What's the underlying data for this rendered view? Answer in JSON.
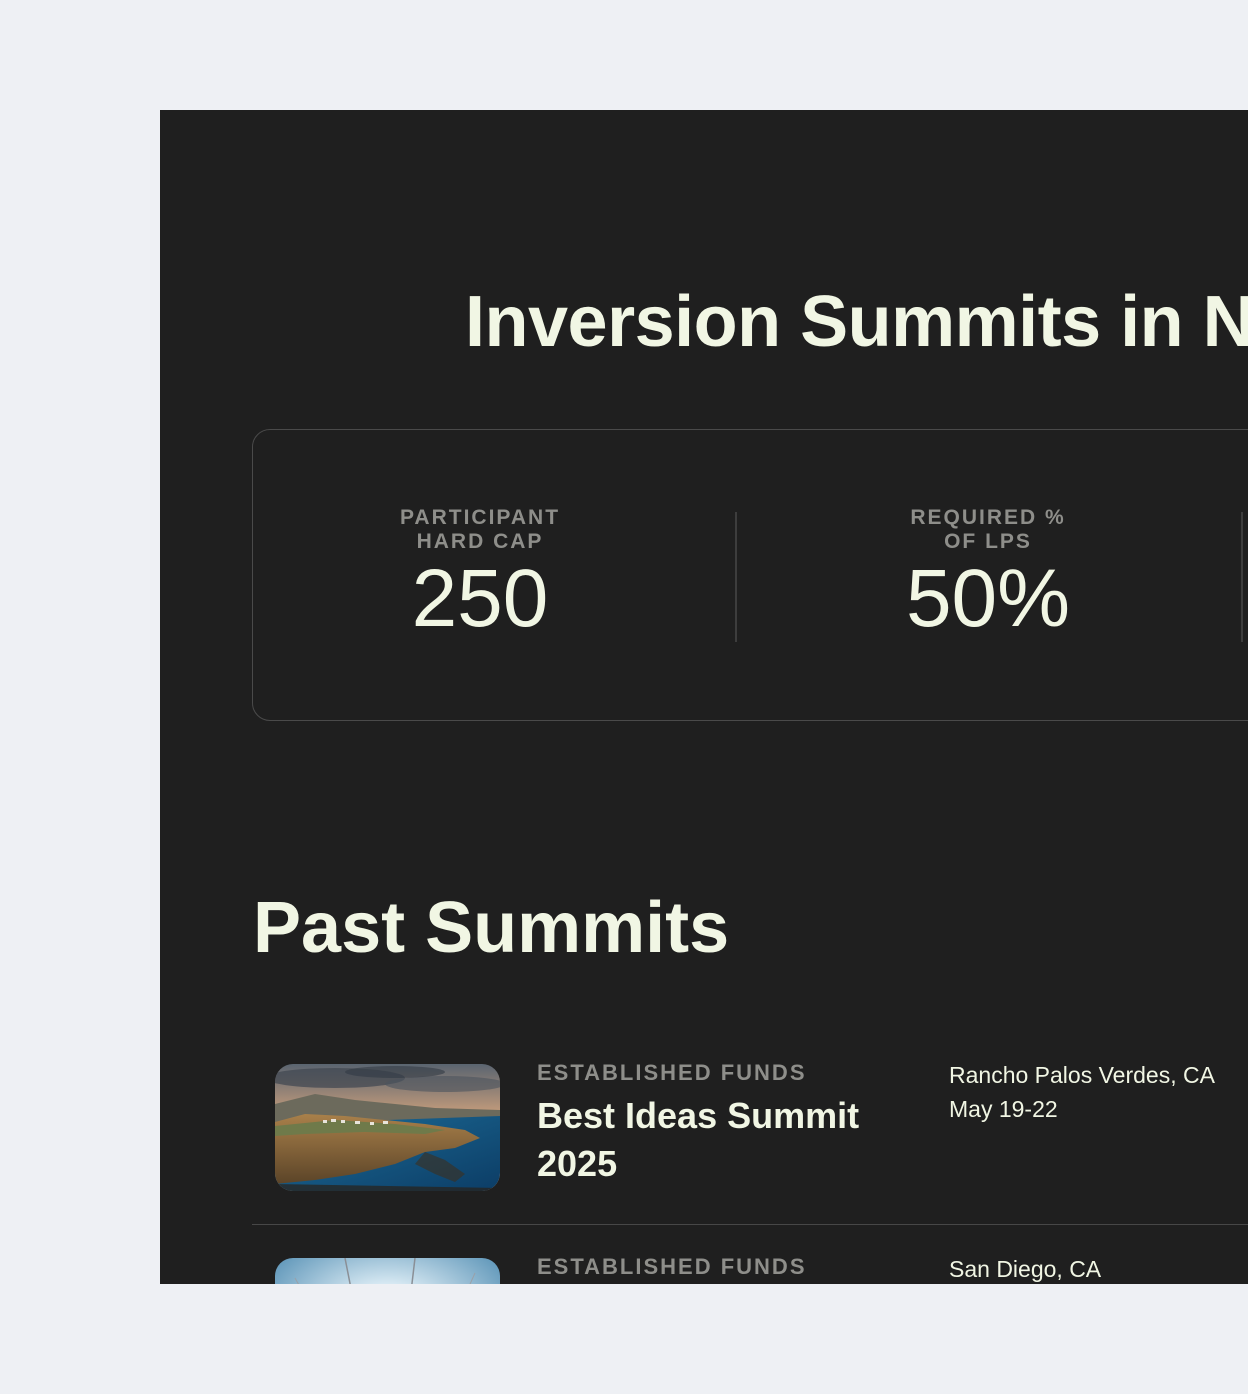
{
  "hero": {
    "title": "Inversion Summits in N"
  },
  "stats": [
    {
      "label": "PARTICIPANT\nHARD CAP",
      "value": "250"
    },
    {
      "label": "REQUIRED %\nOF LPS",
      "value": "50%"
    }
  ],
  "past_summits": {
    "title": "Past Summits",
    "items": [
      {
        "category": "ESTABLISHED FUNDS",
        "name": "Best Ideas Summit 2025",
        "location": "Rancho Palos Verdes, CA",
        "dates": "May 19-22",
        "image_icon": "coastal-cliff-photo"
      },
      {
        "category": "ESTABLISHED FUNDS",
        "name": "",
        "location": "San Diego, CA",
        "dates": "",
        "image_icon": "sky-sunburst-photo"
      }
    ]
  },
  "colors": {
    "page_background": "#eef0f4",
    "panel_background": "#1f1f1f",
    "heading_text": "#f1f6e4",
    "muted_label": "#8e8e8a",
    "border": "#4a4a4a"
  }
}
